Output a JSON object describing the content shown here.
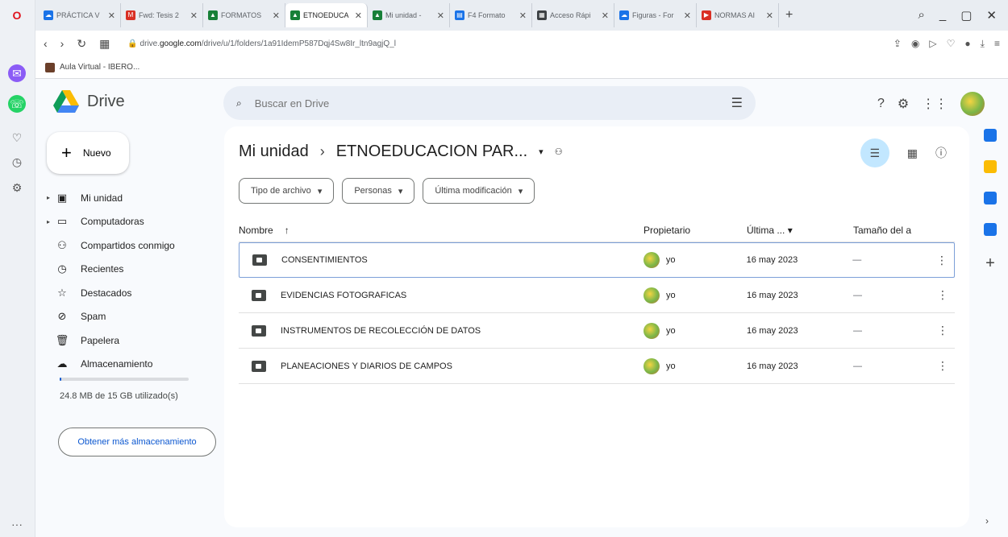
{
  "browser": {
    "tabs": [
      {
        "title": "PRÁCTICA V",
        "icon": "cloud-icon",
        "color": "#1a73e8"
      },
      {
        "title": "Fwd: Tesis 2",
        "icon": "gmail-icon",
        "color": "#d93025"
      },
      {
        "title": "FORMATOS",
        "icon": "drive-icon",
        "color": "#188038"
      },
      {
        "title": "ETNOEDUCA",
        "icon": "drive-icon",
        "color": "#188038",
        "active": true
      },
      {
        "title": "Mi unidad -",
        "icon": "drive-icon",
        "color": "#188038"
      },
      {
        "title": "F4 Formato",
        "icon": "docs-icon",
        "color": "#1a73e8"
      },
      {
        "title": "Acceso Rápi",
        "icon": "grid-icon",
        "color": "#3c4043"
      },
      {
        "title": "Figuras - For",
        "icon": "cloud-icon",
        "color": "#1a73e8"
      },
      {
        "title": "NORMAS AI",
        "icon": "youtube-icon",
        "color": "#d93025"
      }
    ],
    "url_prefix": "drive.",
    "url_domain": "google.com",
    "url_path": "/drive/u/1/folders/1a91IdemP587Dqj4Sw8Ir_ltn9agjQ_l",
    "bookmark": "Aula Virtual - IBERO..."
  },
  "drive": {
    "app_name": "Drive",
    "search_placeholder": "Buscar en Drive",
    "new_label": "Nuevo",
    "nav": [
      {
        "label": "Mi unidad",
        "icon": "my-drive-icon",
        "glyph": "▣",
        "caret": true
      },
      {
        "label": "Computadoras",
        "icon": "computer-icon",
        "glyph": "▭",
        "caret": true
      },
      {
        "label": "Compartidos conmigo",
        "icon": "shared-icon",
        "glyph": "⚇",
        "caret": false
      },
      {
        "label": "Recientes",
        "icon": "clock-icon",
        "glyph": "◷",
        "caret": false
      },
      {
        "label": "Destacados",
        "icon": "star-icon",
        "glyph": "☆",
        "caret": false
      },
      {
        "label": "Spam",
        "icon": "spam-icon",
        "glyph": "⊘",
        "caret": false
      },
      {
        "label": "Papelera",
        "icon": "trash-icon",
        "glyph": "🗑",
        "caret": false
      },
      {
        "label": "Almacenamiento",
        "icon": "cloud-icon",
        "glyph": "☁",
        "caret": false
      }
    ],
    "storage_text": "24.8 MB de 15 GB utilizado(s)",
    "storage_fraction": 0.0016,
    "more_storage_label": "Obtener más almacenamiento"
  },
  "main": {
    "breadcrumb_root": "Mi unidad",
    "breadcrumb_sep": "›",
    "breadcrumb_current": "ETNOEDUCACION PAR...",
    "filters": [
      "Tipo de archivo",
      "Personas",
      "Última modificación"
    ],
    "columns": {
      "name": "Nombre",
      "owner": "Propietario",
      "modified": "Última ...",
      "size": "Tamaño del a"
    },
    "rows": [
      {
        "name": "CONSENTIMIENTOS",
        "owner": "yo",
        "modified": "16 may 2023",
        "size": "—",
        "selected": true
      },
      {
        "name": "EVIDENCIAS FOTOGRAFICAS",
        "owner": "yo",
        "modified": "16 may 2023",
        "size": "—"
      },
      {
        "name": "INSTRUMENTOS DE RECOLECCIÓN DE DATOS",
        "owner": "yo",
        "modified": "16 may 2023",
        "size": "—"
      },
      {
        "name": "PLANEACIONES Y DIARIOS DE CAMPOS",
        "owner": "yo",
        "modified": "16 may 2023",
        "size": "—"
      }
    ]
  },
  "side_apps": [
    {
      "icon": "calendar-icon",
      "color": "#1a73e8"
    },
    {
      "icon": "keep-icon",
      "color": "#fbbc04"
    },
    {
      "icon": "tasks-icon",
      "color": "#1a73e8"
    },
    {
      "icon": "contacts-icon",
      "color": "#1a73e8"
    }
  ]
}
